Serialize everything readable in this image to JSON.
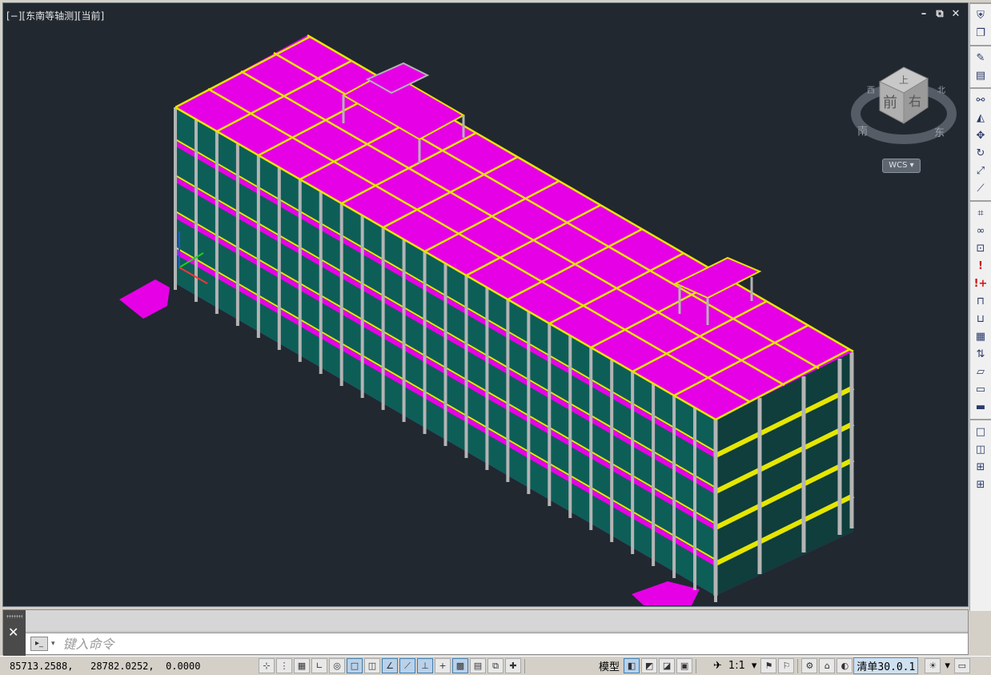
{
  "viewport": {
    "label": "[−][东南等轴测][当前]",
    "controls": {
      "minimize": "–",
      "restore": "⧉",
      "close": "✕"
    }
  },
  "viewcube": {
    "top_face": "上",
    "front_face": "前",
    "right_face": "右",
    "compass_south": "南",
    "compass_east": "东",
    "compass_west": "西",
    "compass_north": "北",
    "wcs": "WCS ▾"
  },
  "right_toolbar": {
    "groups": [
      [
        "shield-icon",
        "copy-objects-icon"
      ],
      [
        "match-properties-icon",
        "properties-palette-icon"
      ],
      [
        "copy-icon",
        "mirror-icon",
        "move-icon",
        "rotate-icon",
        "scale-icon",
        "stretch-icon"
      ],
      [
        "binoculars-icon",
        "glasses-icon",
        "glasses-frame-icon",
        "exclamation-icon",
        "exclamation-plus-icon",
        "lock-icon",
        "unlock-icon",
        "grid-table-icon",
        "swap-icon",
        "edit-shape-icon",
        "frame-icon",
        "ruler-icon"
      ],
      [
        "single-viewport-icon",
        "two-viewports-icon",
        "three-viewports-icon",
        "four-viewports-icon"
      ]
    ]
  },
  "command_line": {
    "close": "✕",
    "prompt_icon": "▸_",
    "caret": "▾",
    "placeholder": "键入命令"
  },
  "statusbar": {
    "coordinates": "85713.2588,   28782.0252,  0.0000",
    "model_label": "模型",
    "scale": "1:1",
    "workspace": "清单30.0.1"
  },
  "colors": {
    "background": "#212830",
    "slab": "#e600e6",
    "beam": "#e6e600",
    "column": "#b4b4b4",
    "glass": "#007a6e"
  }
}
